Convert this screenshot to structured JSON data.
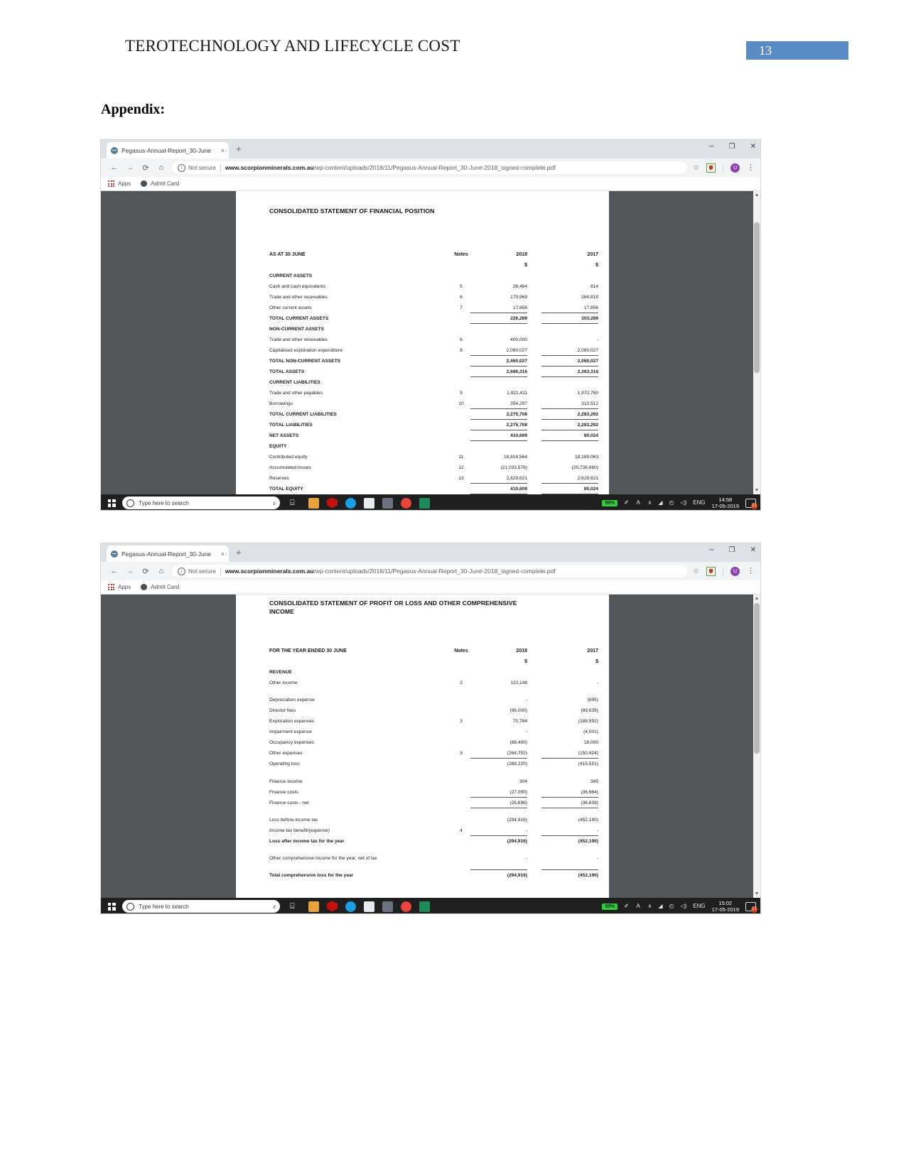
{
  "document": {
    "running_head": "TEROTECHNOLOGY AND LIFECYCLE COST",
    "page_number": "13",
    "page_number_bg": "#5b8cc4",
    "appendix_heading": "Appendix:"
  },
  "browser": {
    "tab_title": "Pegasus-Annual-Report_30-June",
    "tab_close_glyph": "×",
    "new_tab_glyph": "+",
    "window_minimize": "─",
    "window_maximize": "❐",
    "window_close": "✕",
    "back_glyph": "←",
    "forward_glyph": "→",
    "reload_glyph": "⟳",
    "home_glyph": "⌂",
    "security_icon_glyph": "i",
    "security_label": "Not secure",
    "url_domain": "www.scorpionminerals.com.au",
    "url_path": "/wp-content/uploads/2018/11/Pegasus-Annual-Report_30-June-2018_signed-complete.pdf",
    "star_glyph": "☆",
    "avatar_initial": "U",
    "kebab_glyph": "⋮",
    "bookmarks": [
      {
        "name": "apps-grid-icon",
        "label": "Apps"
      },
      {
        "name": "globe-icon",
        "label": "Admit Card"
      }
    ]
  },
  "taskbar": {
    "search_placeholder": "Type here to search",
    "mic_glyph": "ƨ",
    "task_view_glyph": "⌸",
    "battery_percent": "99%",
    "language": "ENG",
    "show_desktop_badge": "21",
    "chevron_glyph": "∧",
    "network_glyph": "◢",
    "wifi_glyph": "◴",
    "volume_glyph": "◁)",
    "pen_glyph": "✐",
    "apps": [
      "task-view-icon",
      "microsoft-store-icon",
      "mcafee-icon",
      "edge-icon",
      "photos-icon",
      "camera-icon",
      "chrome-icon",
      "powerpoint-icon"
    ],
    "shot1_time": "14:58",
    "shot1_date": "17-05-2019",
    "shot2_time": "15:02",
    "shot2_date": "17-05-2019"
  },
  "statement_financial_position": {
    "title": "CONSOLIDATED STATEMENT OF FINANCIAL POSITION",
    "period_label": "AS AT 30 JUNE",
    "col_notes": "Notes",
    "col_2018": "2018",
    "col_2017": "2017",
    "currency": "$",
    "rows": [
      {
        "label": "CURRENT ASSETS",
        "note": "",
        "v2018": "",
        "v2017": "",
        "style": "section"
      },
      {
        "label": "Cash and cash equivalents",
        "note": "5",
        "v2018": "28,464",
        "v2017": "614",
        "style": "item"
      },
      {
        "label": "Trade and other receivables",
        "note": "6",
        "v2018": "179,969",
        "v2017": "284,819",
        "style": "item"
      },
      {
        "label": "Other current assets",
        "note": "7",
        "v2018": "17,856",
        "v2017": "17,856",
        "style": "item-rule"
      },
      {
        "label": "TOTAL CURRENT ASSETS",
        "note": "",
        "v2018": "226,289",
        "v2017": "303,289",
        "style": "total-rule"
      },
      {
        "label": "NON-CURRENT ASSETS",
        "note": "",
        "v2018": "",
        "v2017": "",
        "style": "section"
      },
      {
        "label": "Trade and other receivables",
        "note": "6",
        "v2018": "400,000",
        "v2017": "-",
        "style": "item"
      },
      {
        "label": "Capitalised exploration expenditure",
        "note": "8",
        "v2018": "2,060,027",
        "v2017": "2,060,027",
        "style": "item-rule"
      },
      {
        "label": "TOTAL NON-CURRENT ASSETS",
        "note": "",
        "v2018": "2,460,027",
        "v2017": "2,060,027",
        "style": "total-rule"
      },
      {
        "label": "TOTAL ASSETS",
        "note": "",
        "v2018": "2,686,316",
        "v2017": "2,363,316",
        "style": "total-rule"
      },
      {
        "label": "CURRENT LIABILITIES",
        "note": "",
        "v2018": "",
        "v2017": "",
        "style": "section"
      },
      {
        "label": "Trade and other payables",
        "note": "9",
        "v2018": "1,921,411",
        "v2017": "1,972,780",
        "style": "item"
      },
      {
        "label": "Borrowings",
        "note": "10",
        "v2018": "354,297",
        "v2017": "310,512",
        "style": "item-rule"
      },
      {
        "label": "TOTAL CURRENT LIABILITIES",
        "note": "",
        "v2018": "2,275,708",
        "v2017": "2,283,292",
        "style": "total-rule"
      },
      {
        "label": "TOTAL LIABILITIES",
        "note": "",
        "v2018": "2,275,708",
        "v2017": "2,283,292",
        "style": "total-rule"
      },
      {
        "label": "NET ASSETS",
        "note": "",
        "v2018": "410,609",
        "v2017": "80,024",
        "style": "total-rule"
      },
      {
        "label": "EQUITY",
        "note": "",
        "v2018": "",
        "v2017": "",
        "style": "section"
      },
      {
        "label": "Contributed equity",
        "note": "11",
        "v2018": "18,814,564",
        "v2017": "18,189,063",
        "style": "item"
      },
      {
        "label": "Accumulated losses",
        "note": "12",
        "v2018": "(21,033,576)",
        "v2017": "(20,738,660)",
        "style": "item"
      },
      {
        "label": "Reserves",
        "note": "13",
        "v2018": "2,629,621",
        "v2017": "2,629,621",
        "style": "item-rule"
      },
      {
        "label": "TOTAL EQUITY",
        "note": "",
        "v2018": "410,609",
        "v2017": "80,024",
        "style": "total-rule"
      }
    ]
  },
  "statement_profit_loss": {
    "title_line1": "CONSOLIDATED STATEMENT OF PROFIT OR LOSS AND OTHER COMPREHENSIVE",
    "title_line2": "INCOME",
    "period_label": "FOR THE YEAR ENDED 30 JUNE",
    "col_notes": "Notes",
    "col_2018": "2018",
    "col_2017": "2017",
    "currency": "$",
    "rows": [
      {
        "label": "REVENUE",
        "note": "",
        "v2018": "",
        "v2017": "",
        "style": "section"
      },
      {
        "label": "Other income",
        "note": "2",
        "v2018": "110,148",
        "v2017": "-",
        "style": "item"
      },
      {
        "label": "",
        "note": "",
        "v2018": "",
        "v2017": "",
        "style": "spacer"
      },
      {
        "label": "Depreciation expense",
        "note": "",
        "v2018": "-",
        "v2017": "(695)",
        "style": "item"
      },
      {
        "label": "Director fees",
        "note": "",
        "v2018": "(96,000)",
        "v2017": "(89,839)",
        "style": "item"
      },
      {
        "label": "Exploration expenses",
        "note": "3",
        "v2018": "70,784",
        "v2017": "(188,592)",
        "style": "item"
      },
      {
        "label": "Impairment expense",
        "note": "",
        "v2018": "-",
        "v2017": "(4,001)",
        "style": "item"
      },
      {
        "label": "Occupancy expenses",
        "note": "",
        "v2018": "(88,400)",
        "v2017": "18,000",
        "style": "item"
      },
      {
        "label": "Other expenses",
        "note": "3",
        "v2018": "(264,752)",
        "v2017": "(150,424)",
        "style": "item-rule"
      },
      {
        "label": "Operating loss",
        "note": "",
        "v2018": "(268,220)",
        "v2017": "(415,551)",
        "style": "item"
      },
      {
        "label": "",
        "note": "",
        "v2018": "",
        "v2017": "",
        "style": "spacer"
      },
      {
        "label": "Finance income",
        "note": "",
        "v2018": "304",
        "v2017": "345",
        "style": "item"
      },
      {
        "label": "Finance costs",
        "note": "",
        "v2018": "(27,000)",
        "v2017": "(36,984)",
        "style": "item-rule"
      },
      {
        "label": "Finance costs - net",
        "note": "",
        "v2018": "(26,696)",
        "v2017": "(36,639)",
        "style": "item-rule"
      },
      {
        "label": "",
        "note": "",
        "v2018": "",
        "v2017": "",
        "style": "spacer"
      },
      {
        "label": "Loss before income tax",
        "note": "",
        "v2018": "(294,916)",
        "v2017": "(452,190)",
        "style": "item"
      },
      {
        "label": "Income tax benefit/(expense)",
        "note": "4",
        "v2018": "-",
        "v2017": "-",
        "style": "item-rule"
      },
      {
        "label": "Loss after income tax for the year",
        "note": "",
        "v2018": "(294,916)",
        "v2017": "(452,190)",
        "style": "bold-item"
      },
      {
        "label": "",
        "note": "",
        "v2018": "",
        "v2017": "",
        "style": "spacer"
      },
      {
        "label": "Other comprehensive income for the year, net of tax",
        "note": "",
        "v2018": "-",
        "v2017": "-",
        "style": "item"
      },
      {
        "label": "",
        "note": "",
        "v2018": "",
        "v2017": "",
        "style": "spacer-rule"
      },
      {
        "label": "Total comprehensive loss for the year",
        "note": "",
        "v2018": "(294,916)",
        "v2017": "(452,190)",
        "style": "bold-item"
      }
    ]
  }
}
